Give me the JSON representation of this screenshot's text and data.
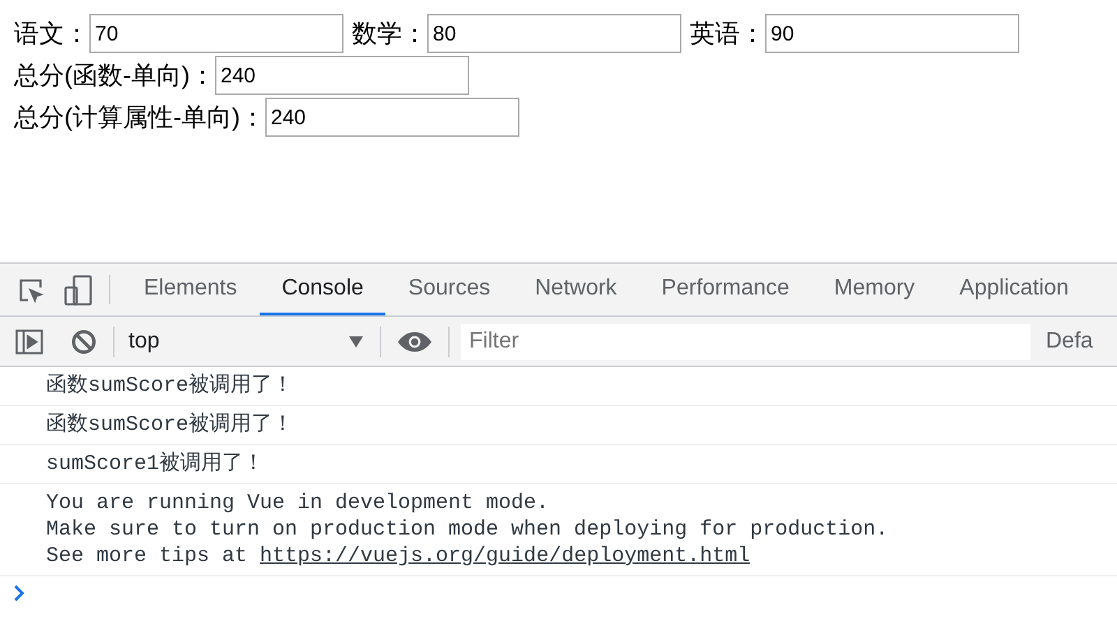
{
  "form": {
    "rows": [
      {
        "fields": [
          {
            "label": "语文：",
            "value": "70"
          },
          {
            "label": "数学：",
            "value": "80"
          },
          {
            "label": "英语：",
            "value": "90"
          }
        ]
      },
      {
        "fields": [
          {
            "label": "总分(函数-单向)：",
            "value": "240"
          }
        ]
      },
      {
        "fields": [
          {
            "label": "总分(计算属性-单向)：",
            "value": "240"
          }
        ]
      }
    ]
  },
  "devtools": {
    "tabs": [
      {
        "label": "Elements",
        "selected": false
      },
      {
        "label": "Console",
        "selected": true
      },
      {
        "label": "Sources",
        "selected": false
      },
      {
        "label": "Network",
        "selected": false
      },
      {
        "label": "Performance",
        "selected": false
      },
      {
        "label": "Memory",
        "selected": false
      },
      {
        "label": "Application",
        "selected": false
      }
    ],
    "toolbar": {
      "context": "top",
      "filter": {
        "placeholder": "Filter"
      },
      "levels": "Defa"
    },
    "messages": [
      {
        "lines": [
          {
            "text": "函数sumScore被调用了！"
          }
        ]
      },
      {
        "lines": [
          {
            "text": "函数sumScore被调用了！"
          }
        ]
      },
      {
        "lines": [
          {
            "text": "sumScore1被调用了！"
          }
        ]
      },
      {
        "lines": [
          {
            "text": "You are running Vue in development mode."
          },
          {
            "text": "Make sure to turn on production mode when deploying for production."
          },
          {
            "text": "See more tips at ",
            "link": "https://vuejs.org/guide/deployment.html"
          }
        ]
      }
    ]
  }
}
